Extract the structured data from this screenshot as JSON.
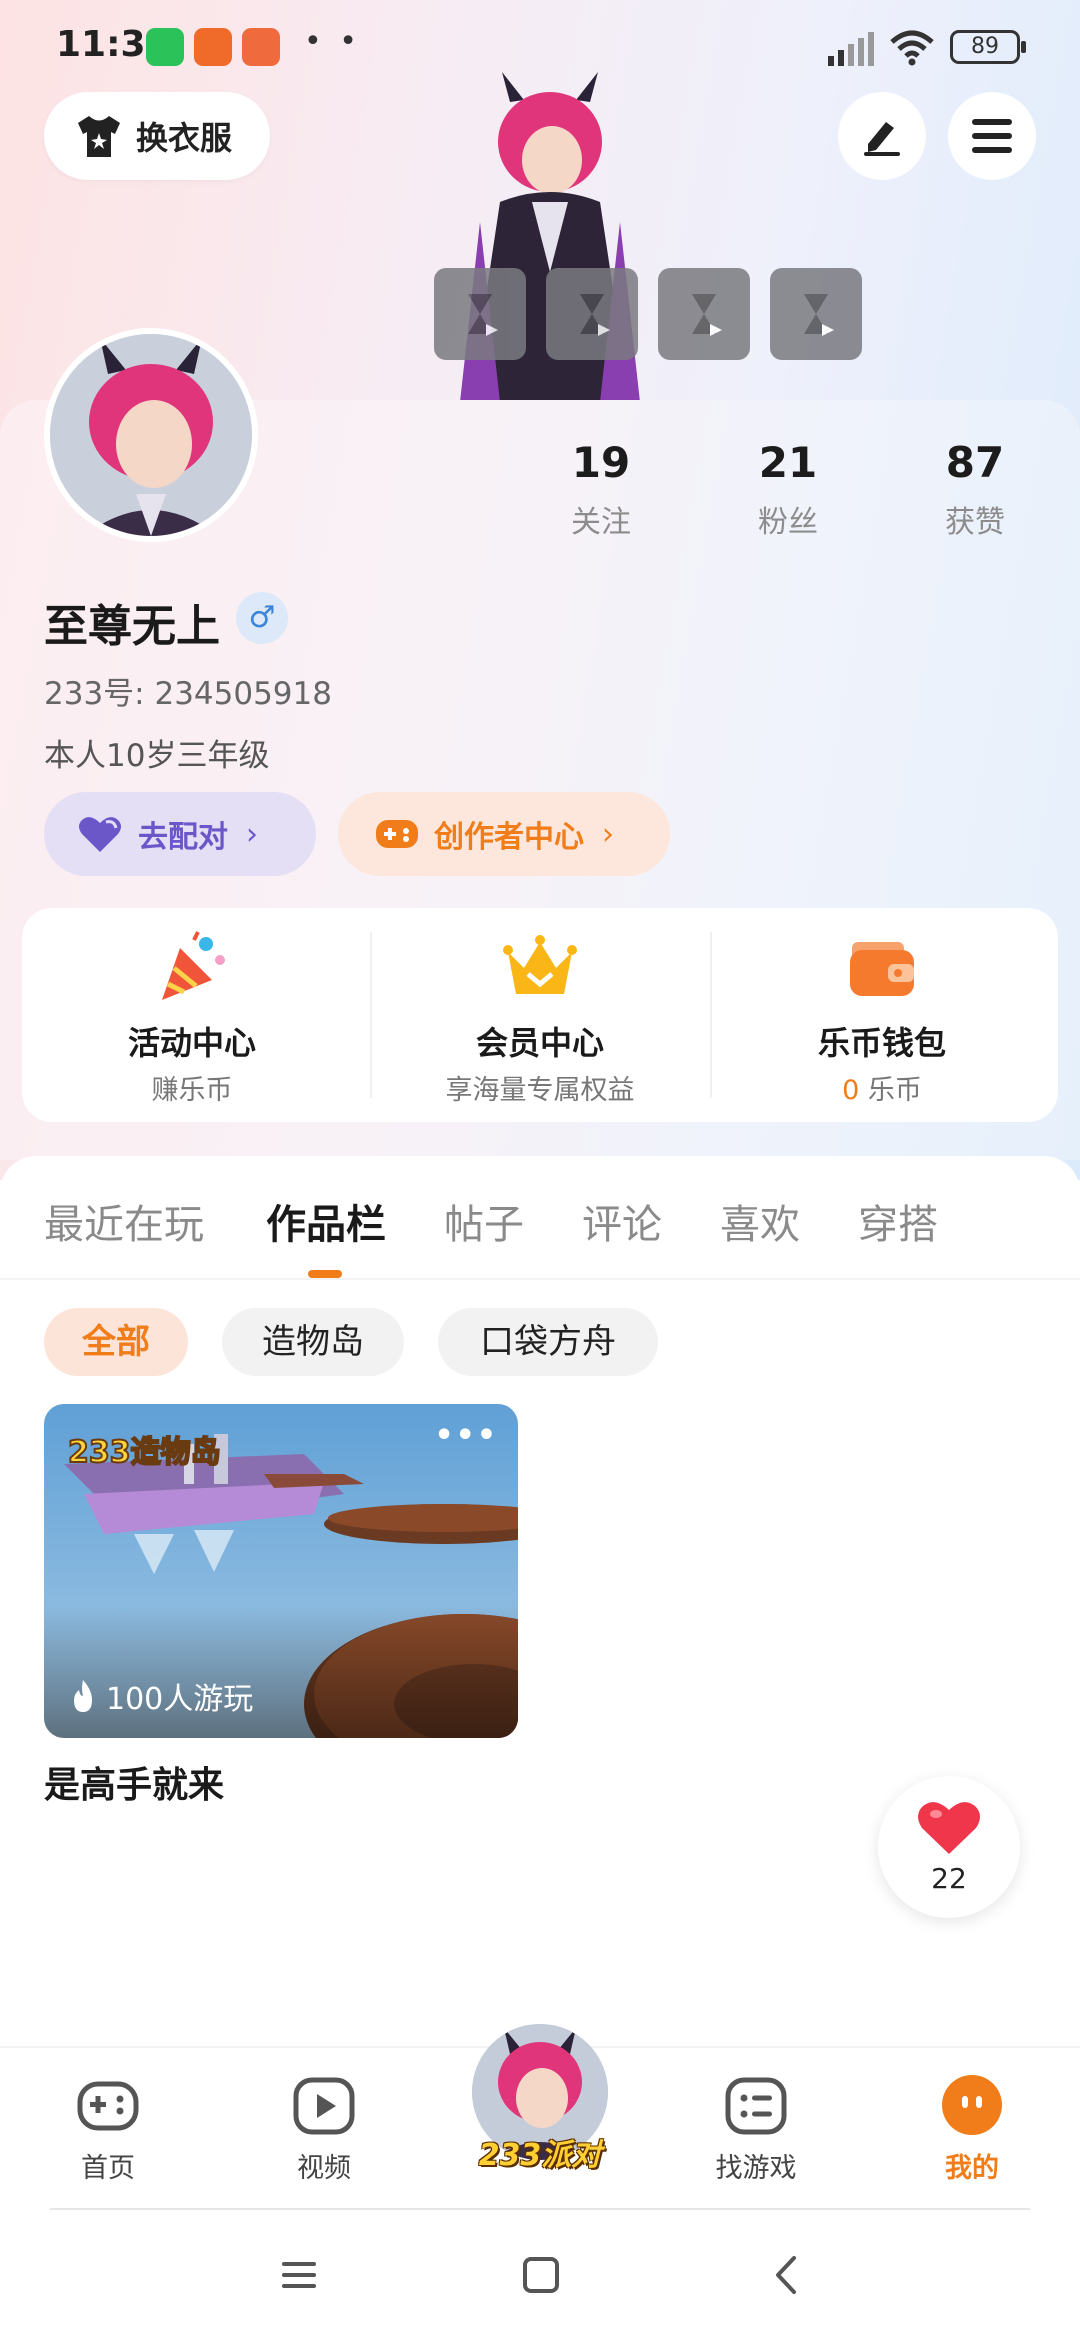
{
  "status_bar": {
    "time": "11:33",
    "battery": "89"
  },
  "header": {
    "wardrobe_label": "换衣服",
    "edit_icon": "edit-icon",
    "menu_icon": "menu-icon"
  },
  "profile": {
    "stats": [
      {
        "value": "19",
        "label": "关注"
      },
      {
        "value": "21",
        "label": "粉丝"
      },
      {
        "value": "87",
        "label": "获赞"
      }
    ],
    "nickname": "至尊无上",
    "gender_symbol": "♂",
    "uid": "233号: 234505918",
    "bio": "本人10岁三年级",
    "match_label": "去配对",
    "creator_label": "创作者中心"
  },
  "features": [
    {
      "title": "活动中心",
      "sub": "赚乐币"
    },
    {
      "title": "会员中心",
      "sub": "享海量专属权益"
    },
    {
      "title": "乐币钱包",
      "sub_value": "0",
      "sub": " 乐币"
    }
  ],
  "tabs": [
    "最近在玩",
    "作品栏",
    "帖子",
    "评论",
    "喜欢",
    "穿搭"
  ],
  "active_tab": "作品栏",
  "filters": [
    "全部",
    "造物岛",
    "口袋方舟"
  ],
  "work": {
    "badge": "100人游玩",
    "title": "是高手就来",
    "logo_text": "233造物岛"
  },
  "like_count": "22",
  "bottom_nav": [
    {
      "label": "首页",
      "icon": "gamepad-icon"
    },
    {
      "label": "视频",
      "icon": "play-icon"
    },
    {
      "label": "233派对",
      "icon": "party-avatar"
    },
    {
      "label": "找游戏",
      "icon": "list-icon"
    },
    {
      "label": "我的",
      "icon": "face-icon"
    }
  ],
  "colors": {
    "accent": "#f07d1a",
    "match_purple": "#6b57c8",
    "gender_blue": "#3a85d8"
  }
}
